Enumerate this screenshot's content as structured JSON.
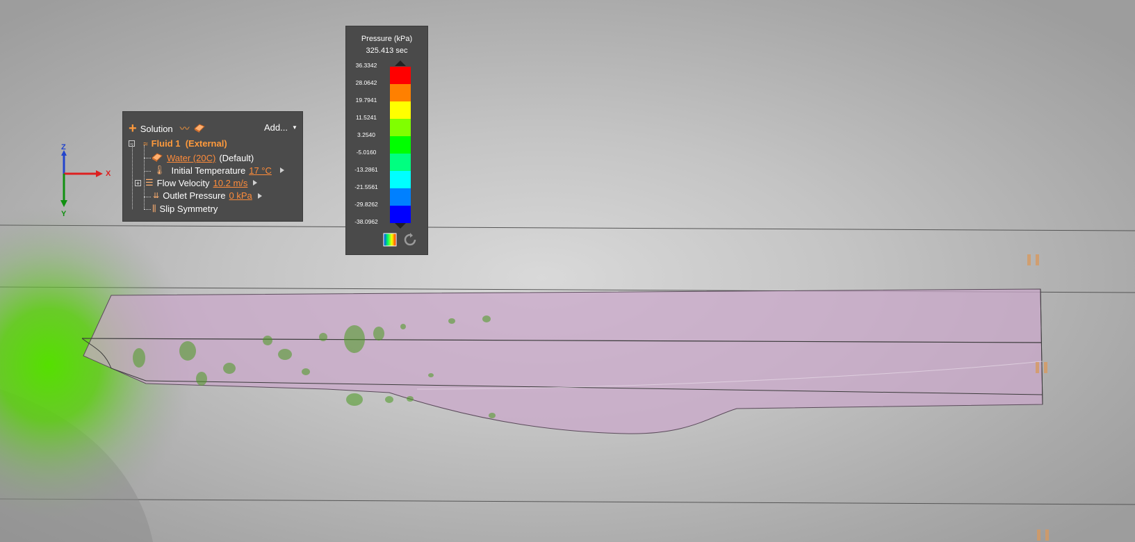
{
  "legend": {
    "title": "Pressure (kPa)",
    "time": "325.413 sec",
    "ticks": [
      "36.3342",
      "28.0642",
      "19.7941",
      "11.5241",
      "3.2540",
      "-5.0160",
      "-13.2861",
      "-21.5561",
      "-29.8262",
      "-38.0962"
    ],
    "colors": [
      "#ff0000",
      "#ff8000",
      "#ffff00",
      "#80ff00",
      "#00ff00",
      "#00ff80",
      "#00ffff",
      "#0080ff",
      "#0000ff"
    ]
  },
  "axes": {
    "z": "Z",
    "x": "X",
    "y": "Y"
  },
  "panel": {
    "solution_label": "Solution",
    "add_label": "Add...",
    "fluid_label": "Fluid 1  (External)",
    "material_link": "Water (20C)",
    "material_default": "(Default)",
    "initial_temp_label": "Initial Temperature",
    "initial_temp_value": "17 °C",
    "flow_velocity_label": "Flow Velocity",
    "flow_velocity_value": "10.2 m/s",
    "outlet_pressure_label": "Outlet Pressure",
    "outlet_pressure_value": "0 kPa",
    "slip_symmetry_label": "Slip Symmetry"
  }
}
